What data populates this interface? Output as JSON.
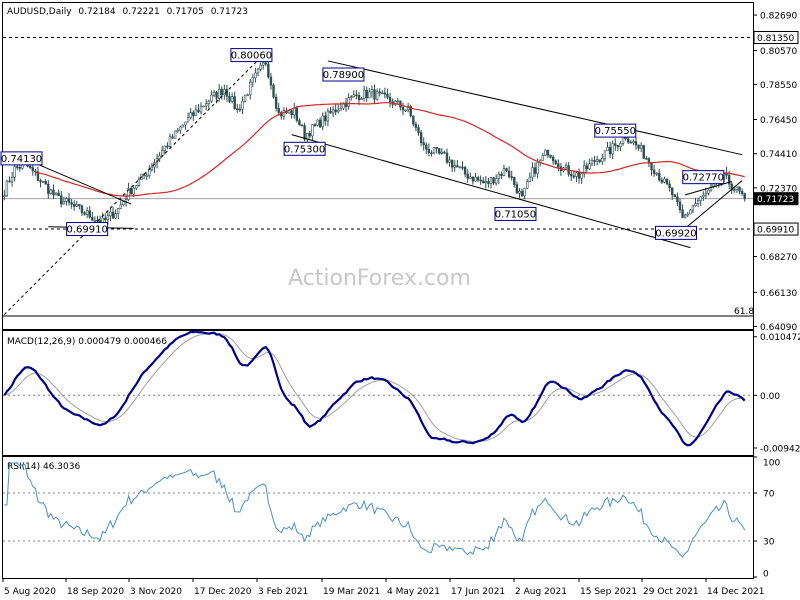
{
  "header": {
    "symbol": "AUDUSD,Daily",
    "open": "0.72184",
    "high": "0.72221",
    "low": "0.71705",
    "close": "0.71723"
  },
  "watermark": "ActionForex.com",
  "colors": {
    "candle": "#2f4f4f",
    "ma": "#d62728",
    "macd": "#00008b",
    "macd_signal": "#a0a0a0",
    "rsi": "#4a90c8",
    "trendline": "#000000",
    "grid": "#808080"
  },
  "chart_data": [
    {
      "type": "candlestick",
      "pane": "price",
      "y_range": [
        0.64,
        0.8335
      ],
      "y_ticks": [
        "0.82690",
        "0.81350",
        "0.80570",
        "0.78550",
        "0.76450",
        "0.74410",
        "0.72370",
        "0.71723",
        "0.69910",
        "0.68270",
        "0.66130",
        "0.64090"
      ],
      "x_labels": [
        "5 Aug 2020",
        "18 Sep 2020",
        "3 Nov 2020",
        "17 Dec 2020",
        "3 Feb 2021",
        "19 Mar 2021",
        "4 May 2021",
        "17 Jun 2021",
        "2 Aug 2021",
        "15 Sep 2021",
        "29 Oct 2021",
        "14 Dec 2021"
      ],
      "horizontal_lines": [
        {
          "value": 0.8135,
          "label": "0.81350",
          "style": "dashed"
        },
        {
          "value": 0.71723,
          "label": "0.71723",
          "style": "solid-grey"
        },
        {
          "value": 0.6991,
          "label": "0.69910",
          "style": "dashed"
        }
      ],
      "annotations": [
        {
          "label": "0.74130",
          "value": 0.7413
        },
        {
          "label": "0.69910",
          "value": 0.6991
        },
        {
          "label": "0.80060",
          "value": 0.8006
        },
        {
          "label": "0.75300",
          "value": 0.753
        },
        {
          "label": "0.78900",
          "value": 0.789
        },
        {
          "label": "0.71050",
          "value": 0.7105
        },
        {
          "label": "0.75550",
          "value": 0.7555
        },
        {
          "label": "0.69920",
          "value": 0.6992
        },
        {
          "label": "0.72770",
          "value": 0.7277
        }
      ],
      "fib_label": "61.8",
      "series_anchors": [
        {
          "i": 0,
          "c": 0.722
        },
        {
          "i": 4,
          "c": 0.735
        },
        {
          "i": 8,
          "c": 0.738
        },
        {
          "i": 14,
          "c": 0.728
        },
        {
          "i": 20,
          "c": 0.718
        },
        {
          "i": 26,
          "c": 0.713
        },
        {
          "i": 32,
          "c": 0.708
        },
        {
          "i": 38,
          "c": 0.703
        },
        {
          "i": 44,
          "c": 0.711
        },
        {
          "i": 48,
          "c": 0.721
        },
        {
          "i": 54,
          "c": 0.731
        },
        {
          "i": 62,
          "c": 0.748
        },
        {
          "i": 70,
          "c": 0.763
        },
        {
          "i": 78,
          "c": 0.775
        },
        {
          "i": 85,
          "c": 0.783
        },
        {
          "i": 90,
          "c": 0.77
        },
        {
          "i": 97,
          "c": 0.79
        },
        {
          "i": 101,
          "c": 0.799
        },
        {
          "i": 106,
          "c": 0.768
        },
        {
          "i": 112,
          "c": 0.769
        },
        {
          "i": 116,
          "c": 0.755
        },
        {
          "i": 122,
          "c": 0.763
        },
        {
          "i": 130,
          "c": 0.773
        },
        {
          "i": 136,
          "c": 0.779
        },
        {
          "i": 142,
          "c": 0.78
        },
        {
          "i": 150,
          "c": 0.775
        },
        {
          "i": 156,
          "c": 0.77
        },
        {
          "i": 162,
          "c": 0.748
        },
        {
          "i": 170,
          "c": 0.742
        },
        {
          "i": 178,
          "c": 0.732
        },
        {
          "i": 186,
          "c": 0.726
        },
        {
          "i": 194,
          "c": 0.735
        },
        {
          "i": 200,
          "c": 0.717
        },
        {
          "i": 204,
          "c": 0.733
        },
        {
          "i": 210,
          "c": 0.746
        },
        {
          "i": 216,
          "c": 0.735
        },
        {
          "i": 222,
          "c": 0.731
        },
        {
          "i": 228,
          "c": 0.74
        },
        {
          "i": 234,
          "c": 0.746
        },
        {
          "i": 240,
          "c": 0.755
        },
        {
          "i": 246,
          "c": 0.746
        },
        {
          "i": 252,
          "c": 0.733
        },
        {
          "i": 258,
          "c": 0.72
        },
        {
          "i": 262,
          "c": 0.705
        },
        {
          "i": 266,
          "c": 0.713
        },
        {
          "i": 272,
          "c": 0.721
        },
        {
          "i": 278,
          "c": 0.73
        },
        {
          "i": 283,
          "c": 0.722
        },
        {
          "i": 286,
          "c": 0.7172
        }
      ]
    },
    {
      "type": "line",
      "pane": "macd",
      "title": "MACD(12,26,9) 0.000479 0.000466",
      "y_range": [
        -0.0105,
        0.0115
      ],
      "y_ticks": [
        "0.010472",
        "0.00",
        "-0.009426"
      ],
      "series": [
        {
          "name": "MACD",
          "role": "main"
        },
        {
          "name": "Signal",
          "role": "signal"
        }
      ]
    },
    {
      "type": "line",
      "pane": "rsi",
      "title": "RSI(14) 46.3036",
      "y_range": [
        0,
        100
      ],
      "y_ticks": [
        "100",
        "70",
        "30",
        "0"
      ],
      "levels": [
        70,
        30
      ]
    }
  ]
}
